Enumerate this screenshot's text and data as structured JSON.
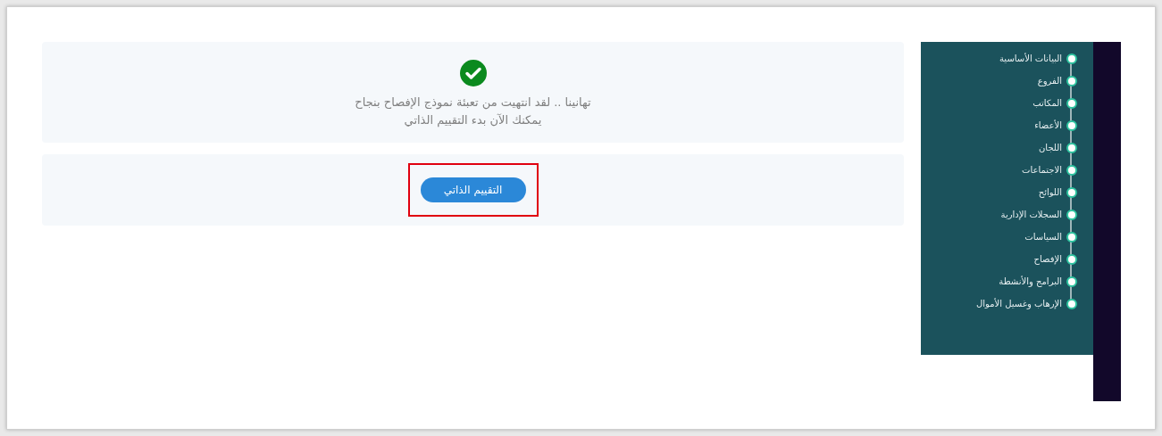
{
  "message": {
    "lines": [
      "تهانينا .. لقد انتهيت من تعبئة نموذج الإفصاح بنجاح",
      "يمكنك الآن بدء التقييم الذاتي"
    ]
  },
  "action": {
    "label": "التقييم الذاتي",
    "highlighted": true
  },
  "sidebar": {
    "items": [
      {
        "label": "البيانات الأساسية"
      },
      {
        "label": "الفروع"
      },
      {
        "label": "المكاتب"
      },
      {
        "label": "الأعضاء"
      },
      {
        "label": "اللجان"
      },
      {
        "label": "الاجتماعات"
      },
      {
        "label": "اللوائح"
      },
      {
        "label": "السجلات الإدارية"
      },
      {
        "label": "السياسات"
      },
      {
        "label": "الإفصاح"
      },
      {
        "label": "البرامج والأنشطة"
      },
      {
        "label": "الإرهاب وغسيل الأموال"
      }
    ]
  }
}
